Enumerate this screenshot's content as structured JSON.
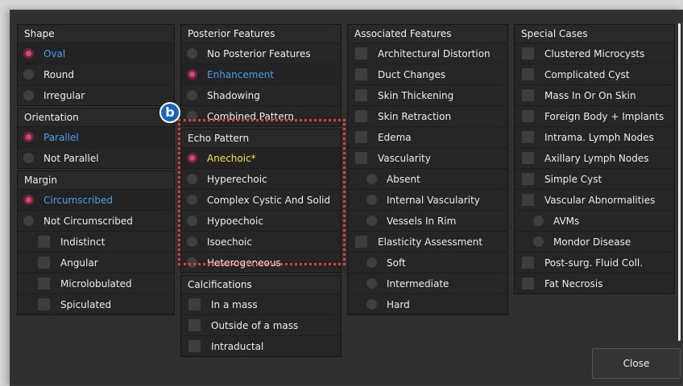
{
  "col1": [
    {
      "title": "Shape",
      "items": [
        {
          "label": "Oval",
          "type": "radio",
          "selected": true
        },
        {
          "label": "Round",
          "type": "radio"
        },
        {
          "label": "Irregular",
          "type": "radio"
        }
      ]
    },
    {
      "title": "Orientation",
      "items": [
        {
          "label": "Parallel",
          "type": "radio",
          "selected": true
        },
        {
          "label": "Not Parallel",
          "type": "radio"
        }
      ]
    },
    {
      "title": "Margin",
      "items": [
        {
          "label": "Circumscribed",
          "type": "radio",
          "selected": true
        },
        {
          "label": "Not Circumscribed",
          "type": "radio"
        },
        {
          "label": "Indistinct",
          "type": "check",
          "indent": 1
        },
        {
          "label": "Angular",
          "type": "check",
          "indent": 1
        },
        {
          "label": "Microlobulated",
          "type": "check",
          "indent": 1
        },
        {
          "label": "Spiculated",
          "type": "check",
          "indent": 1
        }
      ]
    }
  ],
  "col2": [
    {
      "title": "Posterior Features",
      "items": [
        {
          "label": "No Posterior Features",
          "type": "radio"
        },
        {
          "label": "Enhancement",
          "type": "radio",
          "selected": true
        },
        {
          "label": "Shadowing",
          "type": "radio"
        },
        {
          "label": "Combined Pattern",
          "type": "radio"
        }
      ]
    },
    {
      "title": "Echo Pattern",
      "items": [
        {
          "label": "Anechoic*",
          "type": "radio",
          "selected": true,
          "highlight": "yellow"
        },
        {
          "label": "Hyperechoic",
          "type": "radio"
        },
        {
          "label": "Complex Cystic And Solid",
          "type": "radio"
        },
        {
          "label": "Hypoechoic",
          "type": "radio"
        },
        {
          "label": "Isoechoic",
          "type": "radio"
        },
        {
          "label": "Heterogeneous",
          "type": "radio"
        }
      ]
    },
    {
      "title": "Calcifications",
      "items": [
        {
          "label": "In a mass",
          "type": "check"
        },
        {
          "label": "Outside of a mass",
          "type": "check"
        },
        {
          "label": "Intraductal",
          "type": "check"
        }
      ]
    }
  ],
  "col3": [
    {
      "title": "Associated Features",
      "items": [
        {
          "label": "Architectural Distortion",
          "type": "check"
        },
        {
          "label": "Duct Changes",
          "type": "check"
        },
        {
          "label": "Skin Thickening",
          "type": "check"
        },
        {
          "label": "Skin Retraction",
          "type": "check"
        },
        {
          "label": "Edema",
          "type": "check"
        },
        {
          "label": "Vascularity",
          "type": "check"
        },
        {
          "label": "Absent",
          "type": "radio",
          "indent": 1
        },
        {
          "label": "Internal Vascularity",
          "type": "radio",
          "indent": 1
        },
        {
          "label": "Vessels In Rim",
          "type": "radio",
          "indent": 1
        },
        {
          "label": "Elasticity Assessment",
          "type": "check"
        },
        {
          "label": "Soft",
          "type": "radio",
          "indent": 1
        },
        {
          "label": "Intermediate",
          "type": "radio",
          "indent": 1
        },
        {
          "label": "Hard",
          "type": "radio",
          "indent": 1
        }
      ]
    }
  ],
  "col4": [
    {
      "title": "Special Cases",
      "items": [
        {
          "label": "Clustered Microcysts",
          "type": "check"
        },
        {
          "label": "Complicated Cyst",
          "type": "check"
        },
        {
          "label": "Mass In Or On Skin",
          "type": "check"
        },
        {
          "label": "Foreign Body + Implants",
          "type": "check"
        },
        {
          "label": "Intrama. Lymph Nodes",
          "type": "check"
        },
        {
          "label": "Axillary Lymph Nodes",
          "type": "check"
        },
        {
          "label": "Simple Cyst",
          "type": "check"
        },
        {
          "label": "Vascular Abnormalities",
          "type": "check"
        },
        {
          "label": "AVMs",
          "type": "radio",
          "indent": 1
        },
        {
          "label": "Mondor Disease",
          "type": "radio",
          "indent": 1
        },
        {
          "label": "Post-surg. Fluid Coll.",
          "type": "check"
        },
        {
          "label": "Fat Necrosis",
          "type": "check"
        }
      ]
    }
  ],
  "annotation": {
    "badge": "b"
  },
  "close_label": "Close",
  "colors": {
    "selected_radio": "#e0407e",
    "selected_text": "#4aa0ea",
    "highlight_text": "#f2e733",
    "annotation_border": "#e23d3d",
    "badge_bg": "#1565c0"
  }
}
